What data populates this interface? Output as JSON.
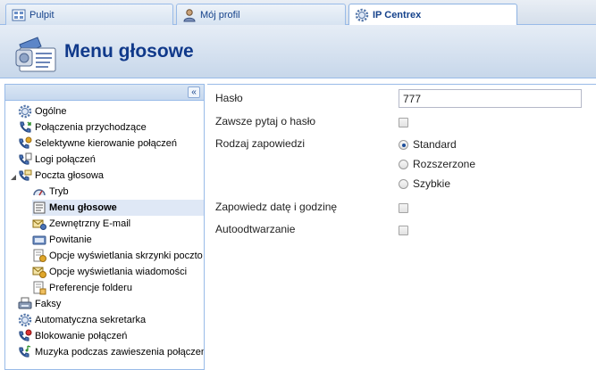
{
  "tabs": [
    {
      "label": "Pulpit",
      "icon": "grid-icon"
    },
    {
      "label": "Mój profil",
      "icon": "user-icon"
    },
    {
      "label": "IP Centrex",
      "icon": "gear-icon",
      "active": true
    }
  ],
  "header": {
    "title": "Menu głosowe",
    "icon": "voice-menu-icon"
  },
  "sidebar": {
    "collapse_label": "«",
    "items": [
      {
        "label": "Ogólne",
        "icon": "gear-icon"
      },
      {
        "label": "Połączenia przychodzące",
        "icon": "incoming-call-icon"
      },
      {
        "label": "Selektywne kierowanie połączeń",
        "icon": "routing-icon"
      },
      {
        "label": "Logi połączeń",
        "icon": "log-icon"
      },
      {
        "label": "Poczta głosowa",
        "icon": "voicemail-icon"
      },
      {
        "label": "Tryb",
        "icon": "mode-icon"
      },
      {
        "label": "Menu głosowe",
        "icon": "menu-icon"
      },
      {
        "label": "Zewnętrzny E-mail",
        "icon": "email-icon"
      },
      {
        "label": "Powitanie",
        "icon": "greeting-icon"
      },
      {
        "label": "Opcje wyświetlania skrzynki poczto",
        "icon": "mailbox-options-icon"
      },
      {
        "label": "Opcje wyświetlania wiadomości",
        "icon": "message-options-icon"
      },
      {
        "label": "Preferencje folderu",
        "icon": "folder-prefs-icon"
      },
      {
        "label": "Faksy",
        "icon": "fax-icon"
      },
      {
        "label": "Automatyczna sekretarka",
        "icon": "answering-machine-icon"
      },
      {
        "label": "Blokowanie połączeń",
        "icon": "block-call-icon"
      },
      {
        "label": "Muzyka podczas zawieszenia połączen",
        "icon": "music-icon"
      }
    ]
  },
  "form": {
    "password_label": "Hasło",
    "password_value": "777",
    "always_ask_label": "Zawsze pytaj o hasło",
    "announcement_type_label": "Rodzaj zapowiedzi",
    "options": [
      "Standard",
      "Rozszerzone",
      "Szybkie"
    ],
    "selected_option": "Standard",
    "announce_datetime_label": "Zapowiedz datę i godzinę",
    "autoplay_label": "Autoodtwarzanie"
  },
  "colors": {
    "accent": "#15428b",
    "title": "#10398a",
    "border": "#99bbe8",
    "selected_bg": "#dfe8f6"
  }
}
